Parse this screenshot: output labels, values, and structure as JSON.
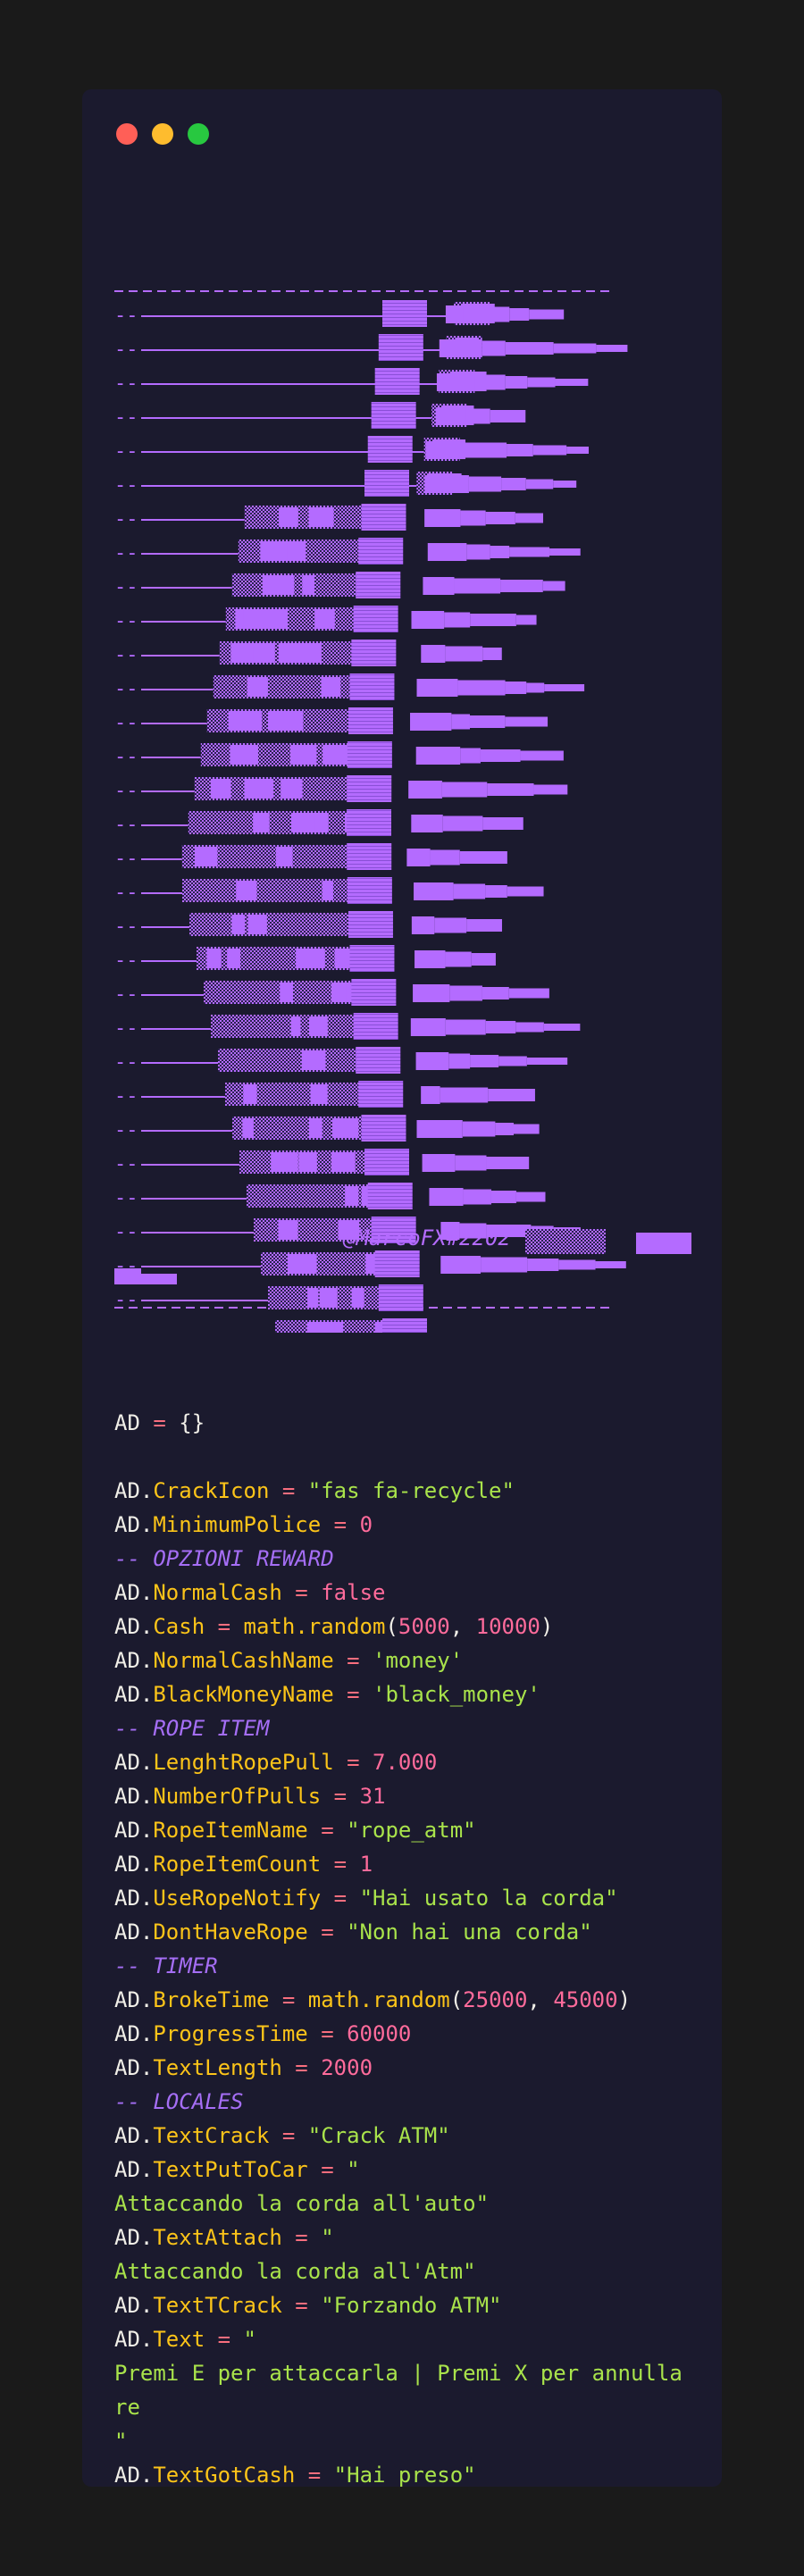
{
  "window": {
    "controls": [
      "close",
      "minimize",
      "maximize"
    ]
  },
  "banner": {
    "signature": "@MarcoFX#2202",
    "color": "#b46bff"
  },
  "code": {
    "lines": [
      {
        "tokens": []
      },
      {
        "tokens": [
          {
            "t": "AD",
            "c": "id"
          },
          {
            "t": " = ",
            "c": "op"
          },
          {
            "t": "{}",
            "c": "pn"
          }
        ]
      },
      {
        "tokens": []
      },
      {
        "tokens": [
          {
            "t": "AD.",
            "c": "id"
          },
          {
            "t": "CrackIcon",
            "c": "prop"
          },
          {
            "t": " = ",
            "c": "op"
          },
          {
            "t": "\"fas fa-recycle\"",
            "c": "str"
          }
        ]
      },
      {
        "tokens": [
          {
            "t": "AD.",
            "c": "id"
          },
          {
            "t": "MinimumPolice",
            "c": "prop"
          },
          {
            "t": " = ",
            "c": "op"
          },
          {
            "t": "0",
            "c": "num"
          }
        ]
      },
      {
        "tokens": [
          {
            "t": "-- OPZIONI REWARD",
            "c": "cm"
          }
        ]
      },
      {
        "tokens": [
          {
            "t": "AD.",
            "c": "id"
          },
          {
            "t": "NormalCash",
            "c": "prop"
          },
          {
            "t": " = ",
            "c": "op"
          },
          {
            "t": "false",
            "c": "kw"
          }
        ]
      },
      {
        "tokens": [
          {
            "t": "AD.",
            "c": "id"
          },
          {
            "t": "Cash",
            "c": "prop"
          },
          {
            "t": " = ",
            "c": "op"
          },
          {
            "t": "math.random",
            "c": "fn"
          },
          {
            "t": "(",
            "c": "pn"
          },
          {
            "t": "5000",
            "c": "num"
          },
          {
            "t": ", ",
            "c": "pn"
          },
          {
            "t": "10000",
            "c": "num"
          },
          {
            "t": ")",
            "c": "pn"
          }
        ]
      },
      {
        "tokens": [
          {
            "t": "AD.",
            "c": "id"
          },
          {
            "t": "NormalCashName",
            "c": "prop"
          },
          {
            "t": " = ",
            "c": "op"
          },
          {
            "t": "'money'",
            "c": "str"
          }
        ]
      },
      {
        "tokens": [
          {
            "t": "AD.",
            "c": "id"
          },
          {
            "t": "BlackMoneyName",
            "c": "prop"
          },
          {
            "t": " = ",
            "c": "op"
          },
          {
            "t": "'black_money'",
            "c": "str"
          }
        ]
      },
      {
        "tokens": [
          {
            "t": "-- ROPE ITEM",
            "c": "cm"
          }
        ]
      },
      {
        "tokens": [
          {
            "t": "AD.",
            "c": "id"
          },
          {
            "t": "LenghtRopePull",
            "c": "prop"
          },
          {
            "t": " = ",
            "c": "op"
          },
          {
            "t": "7.000",
            "c": "num"
          }
        ]
      },
      {
        "tokens": [
          {
            "t": "AD.",
            "c": "id"
          },
          {
            "t": "NumberOfPulls",
            "c": "prop"
          },
          {
            "t": " = ",
            "c": "op"
          },
          {
            "t": "31",
            "c": "num"
          }
        ]
      },
      {
        "tokens": [
          {
            "t": "AD.",
            "c": "id"
          },
          {
            "t": "RopeItemName",
            "c": "prop"
          },
          {
            "t": " = ",
            "c": "op"
          },
          {
            "t": "\"rope_atm\"",
            "c": "str"
          }
        ]
      },
      {
        "tokens": [
          {
            "t": "AD.",
            "c": "id"
          },
          {
            "t": "RopeItemCount",
            "c": "prop"
          },
          {
            "t": " = ",
            "c": "op"
          },
          {
            "t": "1",
            "c": "num"
          }
        ]
      },
      {
        "tokens": [
          {
            "t": "AD.",
            "c": "id"
          },
          {
            "t": "UseRopeNotify",
            "c": "prop"
          },
          {
            "t": " = ",
            "c": "op"
          },
          {
            "t": "\"Hai usato la corda\"",
            "c": "str"
          }
        ]
      },
      {
        "tokens": [
          {
            "t": "AD.",
            "c": "id"
          },
          {
            "t": "DontHaveRope",
            "c": "prop"
          },
          {
            "t": " = ",
            "c": "op"
          },
          {
            "t": "\"Non hai una corda\"",
            "c": "str"
          }
        ]
      },
      {
        "tokens": [
          {
            "t": "-- TIMER",
            "c": "cm"
          }
        ]
      },
      {
        "tokens": [
          {
            "t": "AD.",
            "c": "id"
          },
          {
            "t": "BrokeTime",
            "c": "prop"
          },
          {
            "t": " = ",
            "c": "op"
          },
          {
            "t": "math.random",
            "c": "fn"
          },
          {
            "t": "(",
            "c": "pn"
          },
          {
            "t": "25000",
            "c": "num"
          },
          {
            "t": ", ",
            "c": "pn"
          },
          {
            "t": "45000",
            "c": "num"
          },
          {
            "t": ")",
            "c": "pn"
          }
        ]
      },
      {
        "tokens": [
          {
            "t": "AD.",
            "c": "id"
          },
          {
            "t": "ProgressTime",
            "c": "prop"
          },
          {
            "t": " = ",
            "c": "op"
          },
          {
            "t": "60000",
            "c": "num"
          }
        ]
      },
      {
        "tokens": [
          {
            "t": "AD.",
            "c": "id"
          },
          {
            "t": "TextLength",
            "c": "prop"
          },
          {
            "t": " = ",
            "c": "op"
          },
          {
            "t": "2000",
            "c": "num"
          }
        ]
      },
      {
        "tokens": [
          {
            "t": "-- LOCALES",
            "c": "cm"
          }
        ]
      },
      {
        "tokens": [
          {
            "t": "AD.",
            "c": "id"
          },
          {
            "t": "TextCrack",
            "c": "prop"
          },
          {
            "t": " = ",
            "c": "op"
          },
          {
            "t": "\"Crack ATM\"",
            "c": "str"
          }
        ]
      },
      {
        "tokens": [
          {
            "t": "AD.",
            "c": "id"
          },
          {
            "t": "TextPutToCar",
            "c": "prop"
          },
          {
            "t": " = ",
            "c": "op"
          },
          {
            "t": "\"",
            "c": "str"
          }
        ]
      },
      {
        "tokens": [
          {
            "t": "Attaccando la corda all'auto\"",
            "c": "str"
          }
        ]
      },
      {
        "tokens": [
          {
            "t": "AD.",
            "c": "id"
          },
          {
            "t": "TextAttach",
            "c": "prop"
          },
          {
            "t": " = ",
            "c": "op"
          },
          {
            "t": "\"",
            "c": "str"
          }
        ]
      },
      {
        "tokens": [
          {
            "t": "Attaccando la corda all'Atm\"",
            "c": "str"
          }
        ]
      },
      {
        "tokens": [
          {
            "t": "AD.",
            "c": "id"
          },
          {
            "t": "TextTCrack",
            "c": "prop"
          },
          {
            "t": " = ",
            "c": "op"
          },
          {
            "t": "\"Forzando ATM\"",
            "c": "str"
          }
        ]
      },
      {
        "tokens": [
          {
            "t": "AD.",
            "c": "id"
          },
          {
            "t": "Text",
            "c": "prop"
          },
          {
            "t": " = ",
            "c": "op"
          },
          {
            "t": "\"",
            "c": "str"
          }
        ]
      },
      {
        "tokens": [
          {
            "t": "Premi E per attaccarla | Premi X per annullare",
            "c": "str"
          }
        ]
      },
      {
        "tokens": [
          {
            "t": "\"",
            "c": "str"
          }
        ]
      },
      {
        "tokens": [
          {
            "t": "AD.",
            "c": "id"
          },
          {
            "t": "TextGotCash",
            "c": "prop"
          },
          {
            "t": " = ",
            "c": "op"
          },
          {
            "t": "\"Hai preso\"",
            "c": "str"
          }
        ]
      }
    ]
  }
}
